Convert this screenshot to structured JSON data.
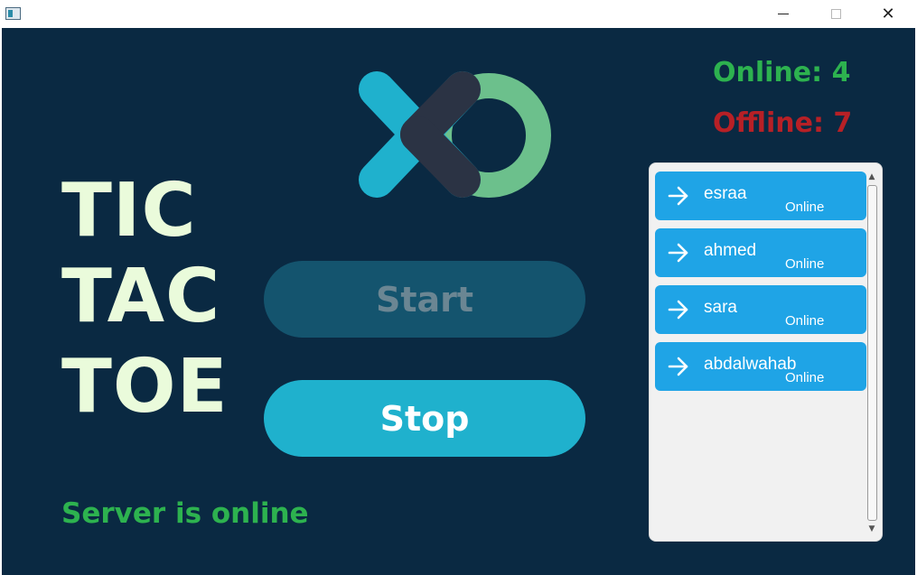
{
  "window": {
    "minimize_glyph": "",
    "close_glyph": "✕"
  },
  "colors": {
    "background": "#0a2942",
    "title_text": "#eafbdb",
    "online_green": "#2db24f",
    "offline_red": "#b72026",
    "start_button": "#14546e",
    "stop_button": "#1fb1cd",
    "player_card": "#1fa4e6",
    "logo_x_cyan": "#1fb1cd",
    "logo_x_dark": "#2b3344",
    "logo_o_green": "#6cc08c"
  },
  "title": {
    "line1": "TIC",
    "line2": "TAC",
    "line3": "TOE"
  },
  "buttons": {
    "start_label": "Start",
    "stop_label": "Stop"
  },
  "server_status": "Server is online",
  "stats": {
    "online": "Online: 4",
    "offline": "Offline: 7"
  },
  "players": [
    {
      "name": "esraa",
      "status": "Online",
      "icon": "arrow-right-icon"
    },
    {
      "name": "ahmed",
      "status": "Online",
      "icon": "arrow-right-icon"
    },
    {
      "name": "sara",
      "status": "Online",
      "icon": "arrow-right-icon"
    },
    {
      "name": "abdalwahab",
      "status": "Online",
      "icon": "arrow-right-icon"
    }
  ]
}
